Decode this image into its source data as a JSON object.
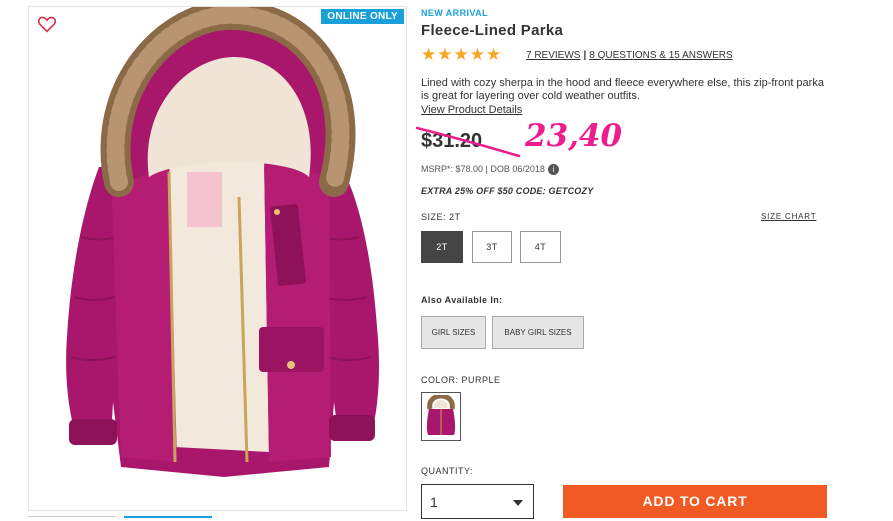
{
  "product_image": {
    "badge": "ONLINE ONLY",
    "heart_icon": "heart-outline-icon"
  },
  "product": {
    "tag": "NEW ARRIVAL",
    "title": "Fleece-Lined Parka",
    "rating": 5,
    "stars": "★★★★★",
    "reviews_link": "7 REVIEWS",
    "questions_link": "8 QUESTIONS & 15 ANSWERS",
    "description": "Lined with cozy sherpa in the hood and fleece everywhere else, this zip-front parka is great for layering over cold weather outfits.",
    "details_link": "View Product Details"
  },
  "pricing": {
    "price": "$31.20",
    "handwritten_price": "23,40",
    "msrp": "MSRP*: $78.00 | DOB 06/2018",
    "info_icon": "i",
    "promo": "EXTRA 25% OFF $50 CODE: GETCOZY"
  },
  "size": {
    "label": "SIZE:",
    "selected": "2T",
    "chart_link": "SIZE CHART",
    "options": [
      "2T",
      "3T",
      "4T"
    ]
  },
  "also_available": {
    "label": "Also Available In:",
    "options": [
      "GIRL SIZES",
      "BABY GIRL SIZES"
    ]
  },
  "color": {
    "label": "COLOR:",
    "selected": "PURPLE"
  },
  "quantity": {
    "label": "QUANTITY:",
    "value": "1"
  },
  "cart": {
    "button_label": "ADD TO CART"
  },
  "colors": {
    "accent_blue": "#19a0d9",
    "star_gold": "#f5a623",
    "cta_orange": "#f15a22",
    "handwriting_pink": "#ee1c8c",
    "parka_magenta": "#a8176b"
  }
}
